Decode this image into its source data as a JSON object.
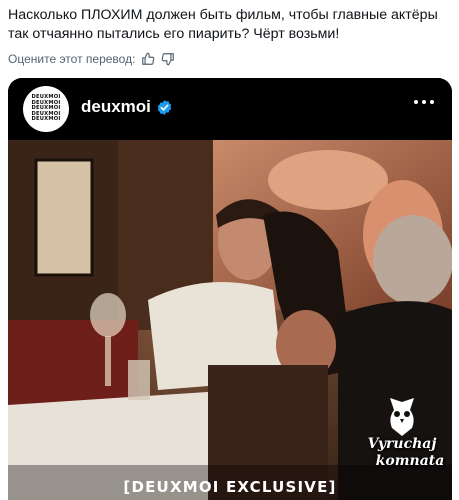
{
  "post": {
    "text": "Насколько ПЛОХИМ должен быть фильм, чтобы главные актёры так отчаянно пытались его пиарить? Чёрт возьми!"
  },
  "translation": {
    "label": "Оцените этот перевод:",
    "like_icon": "thumb-up-icon",
    "dislike_icon": "thumb-down-icon"
  },
  "media": {
    "account_name": "deuxmoi",
    "avatar_lines": [
      "DEUXMOI",
      "DEUXMOI",
      "DEUXMOI",
      "DEUXMOI",
      "DEUXMOI"
    ],
    "caption": "[DEUXMOI EXCLUSIVE]",
    "watermark_line1": "Vyruchaj",
    "watermark_line2": "komnata",
    "verified_color": "#1d9bf0"
  }
}
